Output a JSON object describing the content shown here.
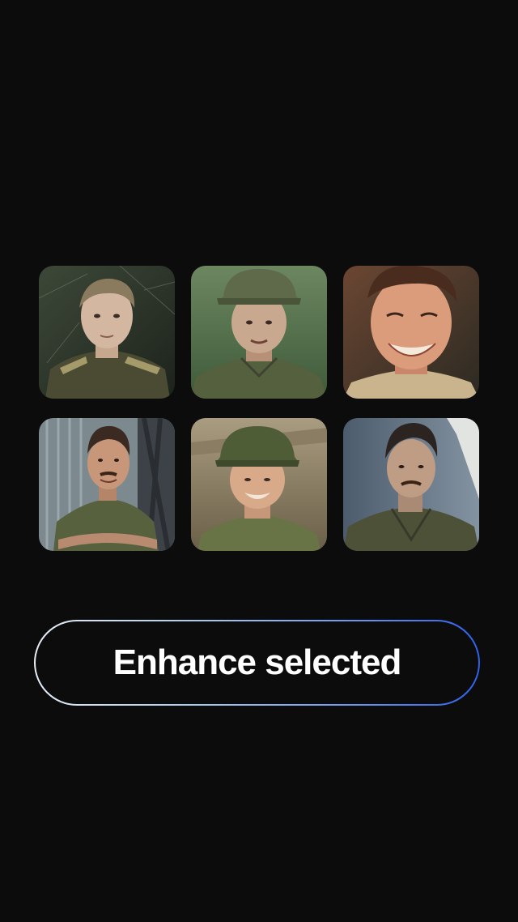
{
  "colors": {
    "background": "#0c0c0d",
    "button_text": "#ffffff",
    "button_border_start": "#e6eef6",
    "button_border_end": "#2f62ea"
  },
  "photo_grid": {
    "photos": [
      {
        "subject": "young man in olive military uniform with shoulder boards, vintage portrait"
      },
      {
        "subject": "soldier wearing field cap, faded color photo"
      },
      {
        "subject": "smiling young man, warm toned close-up"
      },
      {
        "subject": "smiling soldier with mustache, arms crossed, by a metal building"
      },
      {
        "subject": "smiling soldier in field cap, faded photo"
      },
      {
        "subject": "man with mustache in field jacket"
      }
    ]
  },
  "action_button": {
    "label": "Enhance selected"
  }
}
